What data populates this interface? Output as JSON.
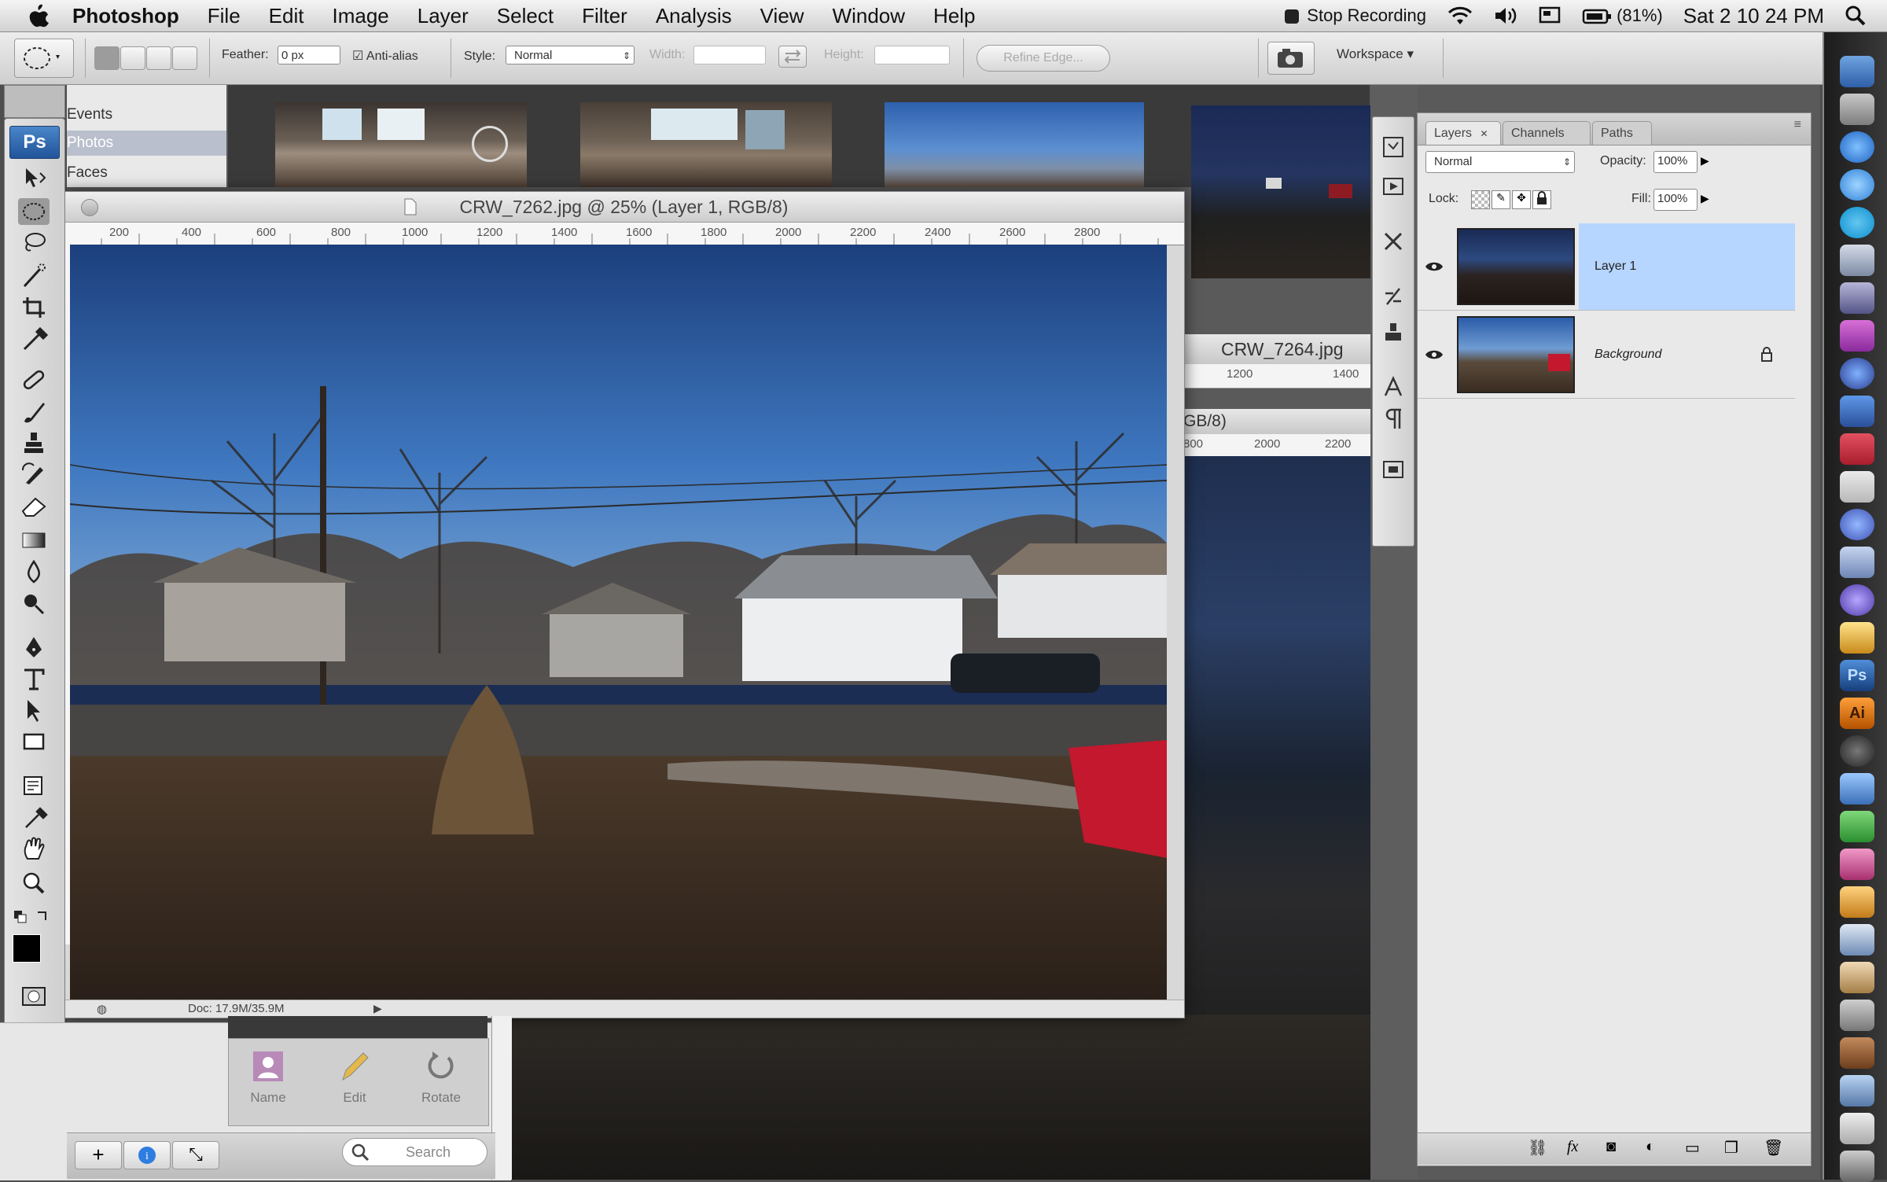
{
  "menubar": {
    "app_name": "Photoshop",
    "items": [
      "File",
      "Edit",
      "Image",
      "Layer",
      "Select",
      "Filter",
      "Analysis",
      "View",
      "Window",
      "Help"
    ],
    "status": {
      "recording": "Stop Recording",
      "battery": "(81%)",
      "clock": "Sat 2 10 24 PM"
    }
  },
  "options_bar": {
    "feather_label": "Feather:",
    "feather_value": "0 px",
    "antialias_label": "Anti-alias",
    "style_label": "Style:",
    "style_value": "Normal",
    "width_label": "Width:",
    "height_label": "Height:",
    "refine_edge": "Refine Edge...",
    "workspace": "Workspace"
  },
  "bridge": {
    "sidebar_items": [
      "Events",
      "Photos",
      "Faces"
    ],
    "actions": [
      "Name",
      "Edit",
      "Rotate"
    ],
    "search_placeholder": "Search"
  },
  "tools": {
    "logo": "Ps"
  },
  "document": {
    "title": "CRW_7262.jpg @ 25% (Layer 1, RGB/8)",
    "ruler_ticks": [
      "200",
      "400",
      "600",
      "800",
      "1000",
      "1200",
      "1400",
      "1600",
      "1800",
      "2000",
      "2200",
      "2400",
      "2600",
      "2800"
    ],
    "status": "Doc: 17.9M/35.9M"
  },
  "document2": {
    "title": "CRW_7264.jpg",
    "ruler_ticks": [
      "1200",
      "1400"
    ],
    "title2": "GB/8)",
    "ruler_ticks2": [
      "800",
      "2000",
      "2200"
    ]
  },
  "layers_panel": {
    "tabs": [
      "Layers",
      "Channels",
      "Paths"
    ],
    "blend_mode": "Normal",
    "opacity_label": "Opacity:",
    "opacity_value": "100%",
    "lock_label": "Lock:",
    "fill_label": "Fill:",
    "fill_value": "100%",
    "layers": [
      {
        "name": "Layer 1",
        "selected": true
      },
      {
        "name": "Background",
        "selected": false
      }
    ]
  }
}
